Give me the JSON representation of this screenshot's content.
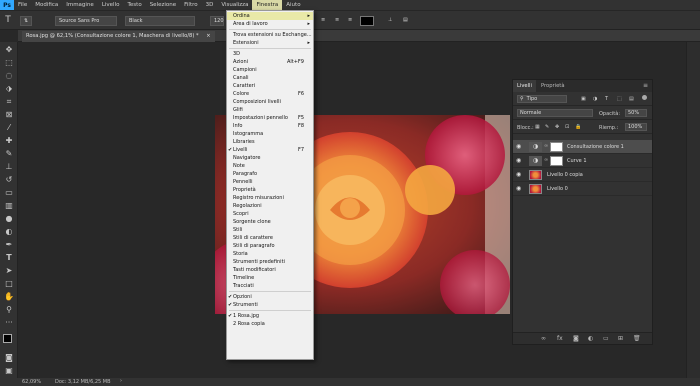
{
  "app": {
    "logo": "Ps"
  },
  "menubar": [
    "File",
    "Modifica",
    "Immagine",
    "Livello",
    "Testo",
    "Selezione",
    "Filtro",
    "3D",
    "Visualizza",
    "Finestra",
    "Aiuto"
  ],
  "optionsbar": {
    "font_family": "Source Sans Pro",
    "font_style": "Black",
    "font_size": "120"
  },
  "document_tab": {
    "title": "Rosa.jpg @ 62,1% (Consultazione colore 1, Maschera di livello/8) *",
    "close": "×"
  },
  "window_menu": {
    "items": [
      {
        "label": "Ordina",
        "arrow": true,
        "highlight": true
      },
      {
        "label": "Area di lavoro",
        "arrow": true
      },
      {
        "sep": true
      },
      {
        "label": "Trova estensioni su Exchange..."
      },
      {
        "label": "Estensioni",
        "arrow": true
      },
      {
        "sep": true
      },
      {
        "label": "3D"
      },
      {
        "label": "Azioni",
        "shortcut": "Alt+F9"
      },
      {
        "label": "Campioni"
      },
      {
        "label": "Canali"
      },
      {
        "label": "Caratteri"
      },
      {
        "label": "Colore",
        "shortcut": "F6"
      },
      {
        "label": "Composizioni livelli"
      },
      {
        "label": "Glifi"
      },
      {
        "label": "Impostazioni pennello",
        "shortcut": "F5"
      },
      {
        "label": "Info",
        "shortcut": "F8"
      },
      {
        "label": "Istogramma"
      },
      {
        "label": "Libraries"
      },
      {
        "label": "Livelli",
        "shortcut": "F7",
        "checked": true
      },
      {
        "label": "Navigatore"
      },
      {
        "label": "Note"
      },
      {
        "label": "Paragrafo"
      },
      {
        "label": "Pennelli"
      },
      {
        "label": "Proprietà"
      },
      {
        "label": "Registro misurazioni"
      },
      {
        "label": "Regolazioni"
      },
      {
        "label": "Scopri"
      },
      {
        "label": "Sorgente clone"
      },
      {
        "label": "Stili"
      },
      {
        "label": "Stili di carattere"
      },
      {
        "label": "Stili di paragrafo"
      },
      {
        "label": "Storia"
      },
      {
        "label": "Strumenti predefiniti"
      },
      {
        "label": "Tasti modificatori"
      },
      {
        "label": "Timeline"
      },
      {
        "label": "Tracciati"
      },
      {
        "sep": true
      },
      {
        "label": "Opzioni",
        "checked": true
      },
      {
        "label": "Strumenti",
        "checked": true
      },
      {
        "sep": true
      },
      {
        "label": "1 Rosa.jpg",
        "checked": true
      },
      {
        "label": "2 Rosa copia"
      }
    ]
  },
  "layers_panel": {
    "tabs": [
      "Livelli",
      "Proprietà"
    ],
    "filter": "Tipo",
    "blend_mode": "Normale",
    "opacity_label": "Opacità:",
    "opacity": "50%",
    "lock_label": "Blocc.:",
    "fill_label": "Riemp.:",
    "fill": "100%",
    "layers": [
      {
        "name": "Consultazione colore 1",
        "selected": true,
        "kind": "adjustment"
      },
      {
        "name": "Curve 1",
        "kind": "adjustment"
      },
      {
        "name": "Livello 0 copia",
        "kind": "image"
      },
      {
        "name": "Livello 0",
        "kind": "image"
      }
    ]
  },
  "statusbar": {
    "zoom": "62,09%",
    "doc": "Doc: 3,12 MB/6,25 MB"
  },
  "colors": {
    "accent": "#31a8ff",
    "menu_highlight": "#e9e9a8",
    "panel_bg": "#323232"
  }
}
